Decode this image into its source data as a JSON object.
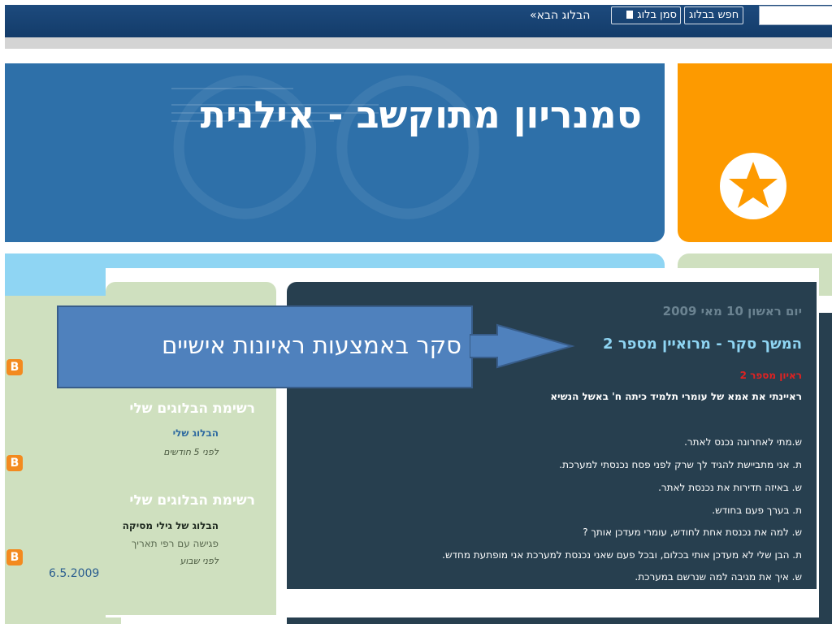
{
  "navbar": {
    "search_button": "חפש בבלוג",
    "flag_button": "סמן בלוג",
    "flag_icon": "flag-icon",
    "next_blog": "הבלוג הבא»"
  },
  "header": {
    "title": "סמנריון מתוקשב - אילנית",
    "badge_icon": "star-icon"
  },
  "sidebar": {
    "sections": [
      {
        "heading": "רשימת הבלוגים שלי",
        "link": "הבלוג שלי",
        "meta": "לפני 5 חודשים"
      },
      {
        "heading": "רשימת הבלוגים שלי",
        "link": "הבלוג של גילי מסיקה",
        "snippet": "פגישה עם רפי תאריך",
        "meta": "לפני שבוע",
        "overflow": "6.5.2009"
      }
    ],
    "badge_icon": "blogger-icon"
  },
  "post": {
    "date": "יום ראשון 10 מאי 2009",
    "title": "המשך סקר - מרואיין מספר 2",
    "subtitle": "ראיון מספר 2",
    "intro": "ראיינתי את אמא של עומרי תלמיד כיתה ח' באשל הנשיא",
    "lines": [
      "ש.מתי לאחרונה נכנס לאתר.",
      "ת. אני מתביישת להגיד לך שרק לפני פסח נכנסתי למערכת.",
      "ש. באיזה תדירות את נכנסת לאתר.",
      "ת. בערך פעם בחודש.",
      "ש. למה את נכנסת אחת לחודש, עומרי מעדכן אותך ?",
      "ת. הבן שלי לא מעדכן אותי בכלום, ובכל פעם שאני נכנסת למערכת אני מופתעת מחדש.",
      "ש. איך את מגיבה למה שנרשם במערכת."
    ]
  },
  "callout": {
    "text": "סקר באמצעות ראיונות אישיים"
  },
  "colors": {
    "navbar": "#133c6a",
    "header": "#2e70a9",
    "orange": "#fd9a00",
    "light_blue": "#8fd5f3",
    "sidebar_green": "#cfe0bf",
    "post_bg": "#273f4f",
    "callout": "#4f81bd",
    "accent_red": "#e02222"
  }
}
